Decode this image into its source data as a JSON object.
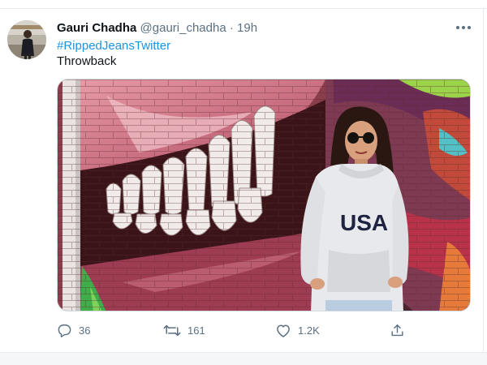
{
  "tweet": {
    "author_name": "Gauri Chadha",
    "handle": "@gauri_chadha",
    "separator": "·",
    "time": "19h",
    "hashtag": "#RippedJeansTwitter",
    "text": "Throwback",
    "photo_print": "USA"
  },
  "actions": {
    "replies": "36",
    "retweets": "161",
    "likes": "1.2K"
  },
  "colors": {
    "link": "#1b95e0",
    "muted": "#5b7083",
    "text": "#0f1419"
  },
  "icons": [
    "more-icon",
    "reply-icon",
    "retweet-icon",
    "like-icon",
    "share-icon"
  ]
}
